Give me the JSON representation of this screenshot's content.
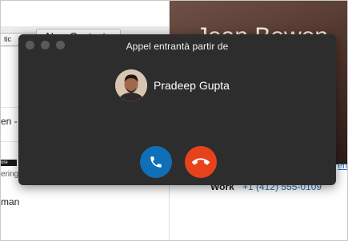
{
  "background_app": {
    "tab_label": "tic",
    "new_contacts_label": "New Contacts",
    "list_fragment_1": "en -",
    "list_fragment_2": "ering",
    "list_fragment_3": "man",
    "tag_label": "ore",
    "contact_name": "Jean Bowen",
    "work_label": "Work",
    "work_phone": "+1 (412) 555-0109",
    "link_fragment": "en"
  },
  "call_popup": {
    "title": "Appel entrantà partir de",
    "caller_name": "Pradeep Gupta",
    "accept_icon": "phone-icon",
    "decline_icon": "phone-hangup-icon",
    "colors": {
      "window_bg": "#2d2d2d",
      "accept": "#0f6fb8",
      "decline": "#e8421c"
    }
  }
}
